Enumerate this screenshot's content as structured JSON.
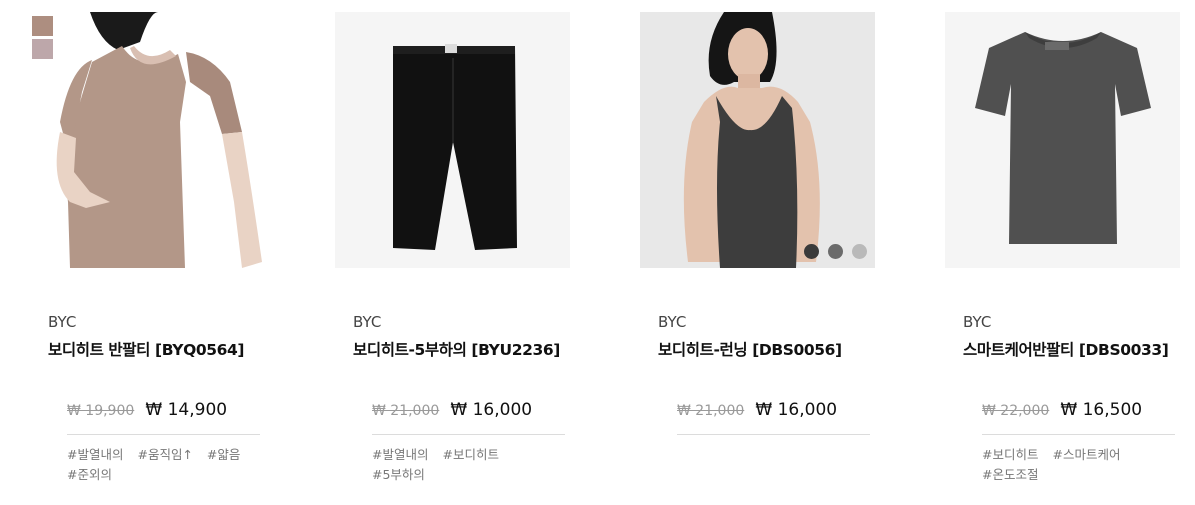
{
  "products": [
    {
      "brand": "BYC",
      "name": "보디히트 반팔티 [BYQ0564]",
      "original_price": "₩ 19,900",
      "sale_price": "₩ 14,900",
      "tags": [
        "#발열내의",
        "#움직임↑",
        "#얇음",
        "#준외의"
      ],
      "image": "beige-shortsleeve-top-on-model",
      "swatches": [
        "#ad8e80",
        "#bda7aa"
      ]
    },
    {
      "brand": "BYC",
      "name": "보디히트-5부하의 [BYU2236]",
      "original_price": "₩ 21,000",
      "sale_price": "₩ 16,000",
      "tags": [
        "#발열내의",
        "#보디히트",
        "#5부하의"
      ],
      "image": "black-5-length-underpants"
    },
    {
      "brand": "BYC",
      "name": "보디히트-런닝 [DBS0056]",
      "original_price": "₩ 21,000",
      "sale_price": "₩ 16,000",
      "tags": [],
      "image": "grey-tank-top-on-model",
      "color_options": [
        "#3a3a3a",
        "#6b6b6b",
        "#b9b9b9"
      ]
    },
    {
      "brand": "BYC",
      "name": "스마트케어반팔티 [DBS0033]",
      "original_price": "₩ 22,000",
      "sale_price": "₩ 16,500",
      "tags": [
        "#보디히트",
        "#스마트케어",
        "#온도조절"
      ],
      "image": "charcoal-tshirt"
    }
  ]
}
